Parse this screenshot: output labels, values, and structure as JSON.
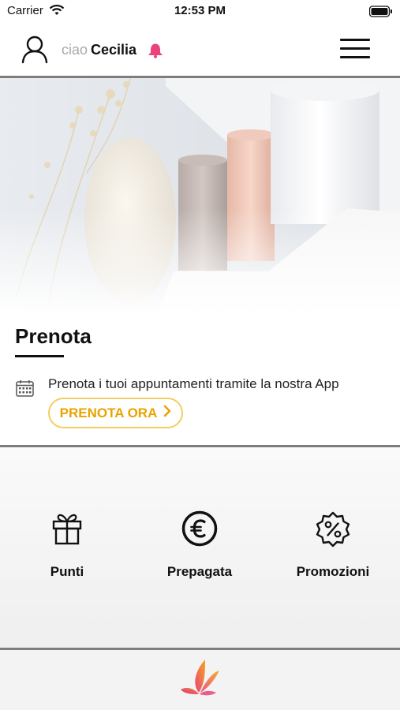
{
  "status": {
    "carrier": "Carrier",
    "time": "12:53 PM"
  },
  "header": {
    "greeting_prefix": "ciao",
    "user_name": "Cecilia"
  },
  "booking": {
    "title": "Prenota",
    "description": "Prenota i tuoi appuntamenti tramite la nostra App",
    "cta_label": "PRENOTA ORA"
  },
  "features": [
    {
      "label": "Punti",
      "icon": "gift-icon"
    },
    {
      "label": "Prepagata",
      "icon": "euro-icon"
    },
    {
      "label": "Promozioni",
      "icon": "percent-badge-icon"
    }
  ],
  "colors": {
    "accent": "#e9a300",
    "accent_border": "#f2ce62",
    "bell": "#e8437a",
    "divider": "#7d7d7d"
  }
}
